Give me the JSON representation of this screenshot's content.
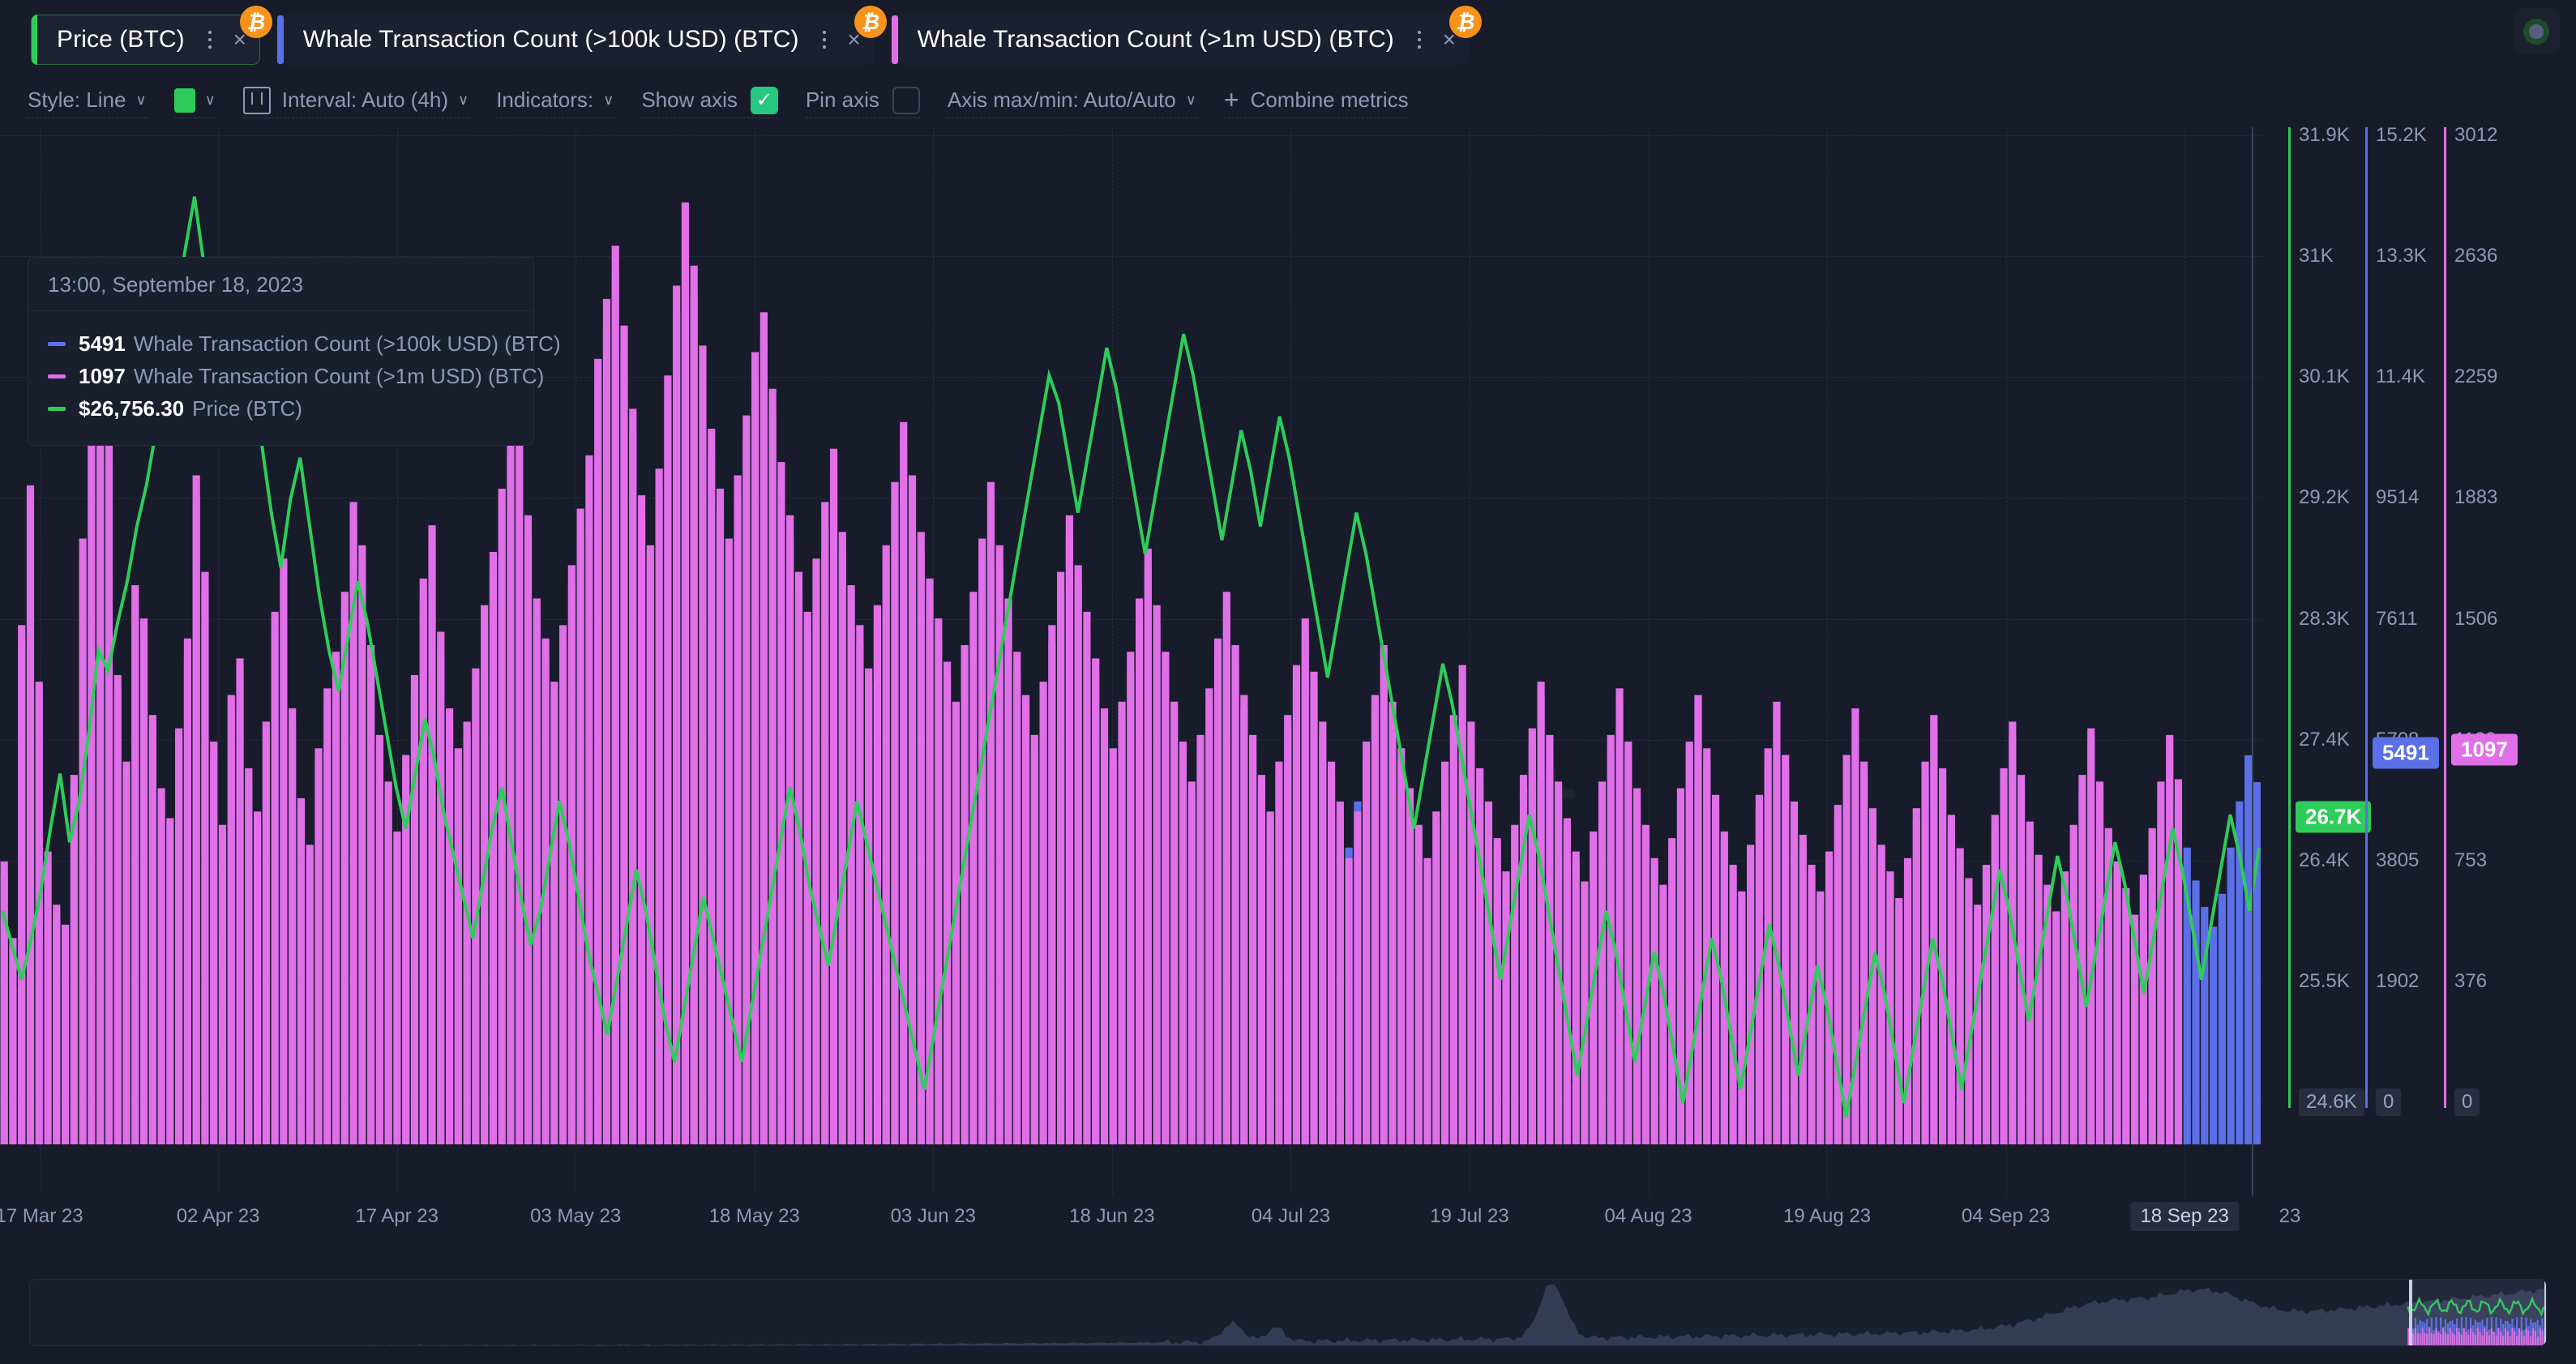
{
  "tabs": [
    {
      "label": "Price (BTC)",
      "color": "#2ECC5A",
      "active": true,
      "badge": "₿",
      "kebab_icon": "kebab-menu-icon",
      "close_icon": "close-icon"
    },
    {
      "label": "Whale Transaction Count (>100k USD) (BTC)",
      "color": "#5B6FE8",
      "active": false,
      "badge": "₿",
      "kebab_icon": "kebab-menu-icon",
      "close_icon": "close-icon"
    },
    {
      "label": "Whale Transaction Count (>1m USD) (BTC)",
      "color": "#E06FE8",
      "active": false,
      "badge": "₿",
      "kebab_icon": "kebab-menu-icon",
      "close_icon": "close-icon"
    }
  ],
  "toolbar": {
    "style_label": "Style: Line",
    "color_swatch": "#2ECC5A",
    "interval_label": "Interval: Auto (4h)",
    "indicators_label": "Indicators:",
    "show_axis_label": "Show axis",
    "show_axis_checked": true,
    "show_axis_check_glyph": "✓",
    "pin_axis_label": "Pin axis",
    "pin_axis_checked": false,
    "axis_maxmin_label": "Axis max/min: Auto/Auto",
    "combine_metrics_label": "Combine metrics",
    "plus_glyph": "+",
    "caret_glyph": "∨"
  },
  "tooltip": {
    "timestamp": "13:00, September 18, 2023",
    "rows": [
      {
        "value": "5491",
        "name": "Whale Transaction Count (>100k USD) (BTC)",
        "color": "#5B6FE8"
      },
      {
        "value": "1097",
        "name": "Whale Transaction Count (>1m USD) (BTC)",
        "color": "#E06FE8"
      },
      {
        "value": "$26,756.30",
        "name": "Price (BTC)",
        "color": "#2ECC5A"
      }
    ]
  },
  "chart_data": {
    "type": "bar",
    "title": "",
    "xlabel": "",
    "grid": true,
    "legend_position": "top-left-tooltip",
    "x_ticks": [
      "17 Mar 23",
      "02 Apr 23",
      "17 Apr 23",
      "03 May 23",
      "18 May 23",
      "03 Jun 23",
      "18 Jun 23",
      "04 Jul 23",
      "19 Jul 23",
      "04 Aug 23",
      "19 Aug 23",
      "04 Sep 23",
      "18 Sep 23"
    ],
    "x_tick_active": "18 Sep 23",
    "x_tick_partial_tail": "23",
    "axes": [
      {
        "name": "Price (BTC)",
        "color": "#2ECC5A",
        "ticks": [
          "31.9K",
          "31K",
          "30.1K",
          "29.2K",
          "28.3K",
          "27.4K",
          "26.4K",
          "25.5K",
          "24.6K"
        ],
        "ylim": [
          24600,
          31900
        ],
        "marker": {
          "label": "26.7K",
          "value": 26756.3,
          "bg": "#2ECC5A",
          "fg": "#FFFFFF"
        },
        "bottom_boxed_tick": "24.6K"
      },
      {
        "name": "Whale Transaction Count (>100k USD) (BTC)",
        "color": "#5B6FE8",
        "ticks": [
          "15.2K",
          "13.3K",
          "11.4K",
          "9514",
          "7611",
          "5708",
          "3805",
          "1902",
          "0"
        ],
        "ylim": [
          0,
          15200
        ],
        "marker": {
          "label": "5491",
          "value": 5491,
          "bg": "#5B6FE8",
          "fg": "#FFFFFF"
        },
        "bottom_boxed_tick": "0"
      },
      {
        "name": "Whale Transaction Count (>1m USD) (BTC)",
        "color": "#E06FE8",
        "ticks": [
          "3012",
          "2636",
          "2259",
          "1883",
          "1506",
          "1129",
          "753",
          "376",
          "0"
        ],
        "ylim": [
          0,
          3012
        ],
        "marker": {
          "label": "1097",
          "value": 1097,
          "bg": "#E06FE8",
          "fg": "#FFFFFF"
        },
        "bottom_boxed_tick": "0"
      }
    ],
    "series": [
      {
        "name": "Whale Transaction Count (>100k USD) (BTC)",
        "type": "bar",
        "color": "#5B6FE8",
        "axis": 1,
        "values": [
          4100,
          3000,
          7600,
          9700,
          6800,
          4300,
          3500,
          3200,
          5400,
          8900,
          12100,
          11200,
          10300,
          6900,
          5600,
          8200,
          7700,
          6300,
          5200,
          4800,
          6100,
          7400,
          9800,
          8400,
          5900,
          4700,
          6600,
          7100,
          5500,
          4900,
          6200,
          7800,
          8600,
          6400,
          5100,
          4400,
          5800,
          6700,
          7200,
          8100,
          9400,
          8800,
          7300,
          6000,
          5300,
          4600,
          5700,
          6900,
          8300,
          9100,
          7500,
          6400,
          5800,
          6200,
          7000,
          7900,
          8700,
          9600,
          10400,
          11000,
          9200,
          8000,
          7400,
          6800,
          7600,
          8500,
          9300,
          10100,
          11500,
          12400,
          13200,
          12000,
          10800,
          9500,
          8800,
          9900,
          11300,
          12600,
          13800,
          12900,
          11700,
          10500,
          9600,
          8900,
          9800,
          10700,
          11600,
          12200,
          11100,
          10000,
          9200,
          8400,
          7800,
          8600,
          9400,
          10200,
          9000,
          8200,
          7600,
          7000,
          7900,
          8800,
          9700,
          10600,
          9800,
          9000,
          8300,
          7700,
          7100,
          6500,
          7300,
          8100,
          8900,
          9700,
          8800,
          8000,
          7200,
          6600,
          6000,
          6800,
          7600,
          8400,
          9200,
          8500,
          7800,
          7100,
          6400,
          5800,
          6500,
          7200,
          8000,
          8700,
          7900,
          7200,
          6500,
          5900,
          5300,
          6000,
          6700,
          7400,
          8100,
          7300,
          6600,
          6000,
          5400,
          4900,
          5600,
          6300,
          7000,
          7700,
          6900,
          6200,
          5600,
          5000,
          4500,
          5200,
          5900,
          6600,
          7300,
          6500,
          5800,
          5200,
          4700,
          4200,
          4900,
          5600,
          6300,
          7000,
          6200,
          5500,
          5000,
          4500,
          4000,
          4700,
          5400,
          6100,
          6800,
          6000,
          5300,
          4800,
          4300,
          3900,
          4600,
          5300,
          6000,
          6700,
          5900,
          5200,
          4700,
          4200,
          3800,
          4500,
          5200,
          5900,
          6600,
          5800,
          5100,
          4600,
          4100,
          3700,
          4400,
          5100,
          5800,
          6500,
          5700,
          5000,
          4500,
          4100,
          3700,
          4300,
          5000,
          5700,
          6400,
          5600,
          4900,
          4400,
          4000,
          3600,
          4200,
          4900,
          5600,
          6300,
          5500,
          4800,
          4300,
          3900,
          3500,
          4100,
          4800,
          5500,
          6200,
          5400,
          4700,
          4200,
          3800,
          3400,
          4000,
          4700,
          5400,
          6100,
          5300,
          4600,
          4100,
          3700,
          3300,
          3900,
          4600,
          5300,
          6000,
          5200,
          4500,
          4000,
          3600,
          3300,
          3800,
          4500,
          5200,
          5900,
          5491
        ]
      },
      {
        "name": "Whale Transaction Count (>1m USD) (BTC)",
        "type": "bar",
        "color": "#E06FE8",
        "axis": 2,
        "values": [
          850,
          620,
          1560,
          1980,
          1390,
          880,
          720,
          660,
          1110,
          1820,
          2480,
          2290,
          2110,
          1410,
          1150,
          1680,
          1580,
          1290,
          1070,
          980,
          1250,
          1520,
          2010,
          1720,
          1210,
          960,
          1350,
          1460,
          1130,
          1000,
          1270,
          1600,
          1760,
          1310,
          1040,
          900,
          1190,
          1370,
          1480,
          1660,
          1930,
          1800,
          1500,
          1230,
          1090,
          940,
          1170,
          1410,
          1700,
          1860,
          1540,
          1310,
          1190,
          1270,
          1430,
          1620,
          1780,
          1970,
          2130,
          2250,
          1890,
          1640,
          1520,
          1390,
          1560,
          1740,
          1910,
          2070,
          2360,
          2540,
          2700,
          2460,
          2210,
          1950,
          1800,
          2030,
          2310,
          2580,
          2830,
          2640,
          2400,
          2150,
          1970,
          1820,
          2010,
          2190,
          2380,
          2500,
          2270,
          2050,
          1890,
          1720,
          1600,
          1760,
          1930,
          2090,
          1840,
          1680,
          1560,
          1430,
          1620,
          1800,
          1990,
          2170,
          2010,
          1840,
          1700,
          1580,
          1450,
          1330,
          1500,
          1660,
          1820,
          1990,
          1800,
          1640,
          1480,
          1350,
          1230,
          1390,
          1560,
          1720,
          1890,
          1740,
          1600,
          1460,
          1310,
          1190,
          1330,
          1480,
          1640,
          1790,
          1620,
          1480,
          1330,
          1210,
          1090,
          1230,
          1370,
          1520,
          1660,
          1500,
          1350,
          1230,
          1110,
          1000,
          1150,
          1290,
          1440,
          1580,
          1420,
          1270,
          1150,
          1030,
          860,
          1000,
          1210,
          1350,
          1500,
          1330,
          1190,
          1070,
          960,
          860,
          1000,
          1150,
          1290,
          1440,
          1270,
          1130,
          1030,
          920,
          820,
          960,
          1110,
          1250,
          1390,
          1230,
          1090,
          980,
          880,
          790,
          940,
          1090,
          1230,
          1370,
          1210,
          1070,
          960,
          860,
          780,
          920,
          1070,
          1210,
          1350,
          1190,
          1050,
          940,
          840,
          760,
          900,
          1050,
          1190,
          1330,
          1170,
          1030,
          930,
          840,
          760,
          880,
          1020,
          1170,
          1310,
          1150,
          1010,
          900,
          820,
          740,
          860,
          1010,
          1150,
          1290,
          1130,
          990,
          890,
          800,
          720,
          840,
          990,
          1130,
          1270,
          1110,
          970,
          870,
          780,
          700,
          820,
          960,
          1110,
          1250,
          1090,
          950,
          850,
          770,
          690,
          810,
          950,
          1090,
          1230,
          1097
        ]
      },
      {
        "name": "Price (BTC)",
        "type": "line",
        "color": "#2ECC5A",
        "axis": 0,
        "values": [
          26300,
          26050,
          25800,
          26100,
          26450,
          26900,
          27300,
          26800,
          27100,
          27600,
          28200,
          28050,
          28400,
          28700,
          29100,
          29400,
          29800,
          30200,
          30600,
          31100,
          31500,
          31000,
          30400,
          30100,
          30500,
          30900,
          30300,
          29700,
          29200,
          28800,
          29300,
          29600,
          29100,
          28600,
          28200,
          27900,
          28300,
          28700,
          28400,
          28000,
          27600,
          27200,
          26900,
          27300,
          27700,
          27400,
          27000,
          26700,
          26400,
          26100,
          26500,
          26900,
          27200,
          26800,
          26400,
          26050,
          26300,
          26700,
          27100,
          26800,
          26400,
          26000,
          25700,
          25400,
          25800,
          26200,
          26600,
          26300,
          25900,
          25500,
          25200,
          25600,
          26000,
          26400,
          26100,
          25800,
          25500,
          25200,
          25600,
          26000,
          26400,
          26800,
          27200,
          26900,
          26500,
          26200,
          25900,
          26300,
          26700,
          27100,
          26800,
          26500,
          26200,
          25900,
          25600,
          25300,
          25000,
          25400,
          25800,
          26200,
          26600,
          27000,
          27400,
          27800,
          28200,
          28600,
          29000,
          29400,
          29800,
          30200,
          30000,
          29600,
          29200,
          29600,
          30000,
          30400,
          30100,
          29700,
          29300,
          28900,
          29300,
          29700,
          30100,
          30500,
          30200,
          29800,
          29400,
          29000,
          29400,
          29800,
          29500,
          29100,
          29500,
          29900,
          29600,
          29200,
          28800,
          28400,
          28000,
          28400,
          28800,
          29200,
          28900,
          28500,
          28100,
          27700,
          27300,
          26900,
          27300,
          27700,
          28100,
          27800,
          27400,
          27000,
          26600,
          26200,
          25800,
          26200,
          26600,
          27000,
          26700,
          26300,
          25900,
          25500,
          25100,
          25500,
          25900,
          26300,
          26000,
          25600,
          25200,
          25600,
          26000,
          25700,
          25300,
          24900,
          25300,
          25700,
          26100,
          25800,
          25400,
          25000,
          25400,
          25800,
          26200,
          25900,
          25500,
          25100,
          25500,
          25900,
          25600,
          25200,
          24800,
          25200,
          25600,
          26000,
          25700,
          25300,
          24900,
          25300,
          25700,
          26100,
          25800,
          25400,
          25000,
          25400,
          25800,
          26200,
          26600,
          26300,
          25900,
          25500,
          25900,
          26300,
          26700,
          26400,
          26000,
          25600,
          26000,
          26400,
          26800,
          26500,
          26100,
          25700,
          26100,
          26500,
          26900,
          26600,
          26200,
          25800,
          26200,
          26600,
          27000,
          26700,
          26300,
          26756
        ]
      }
    ]
  },
  "minimap": {
    "window_left_pct": 94.5,
    "window_width_pct": 5.5
  }
}
